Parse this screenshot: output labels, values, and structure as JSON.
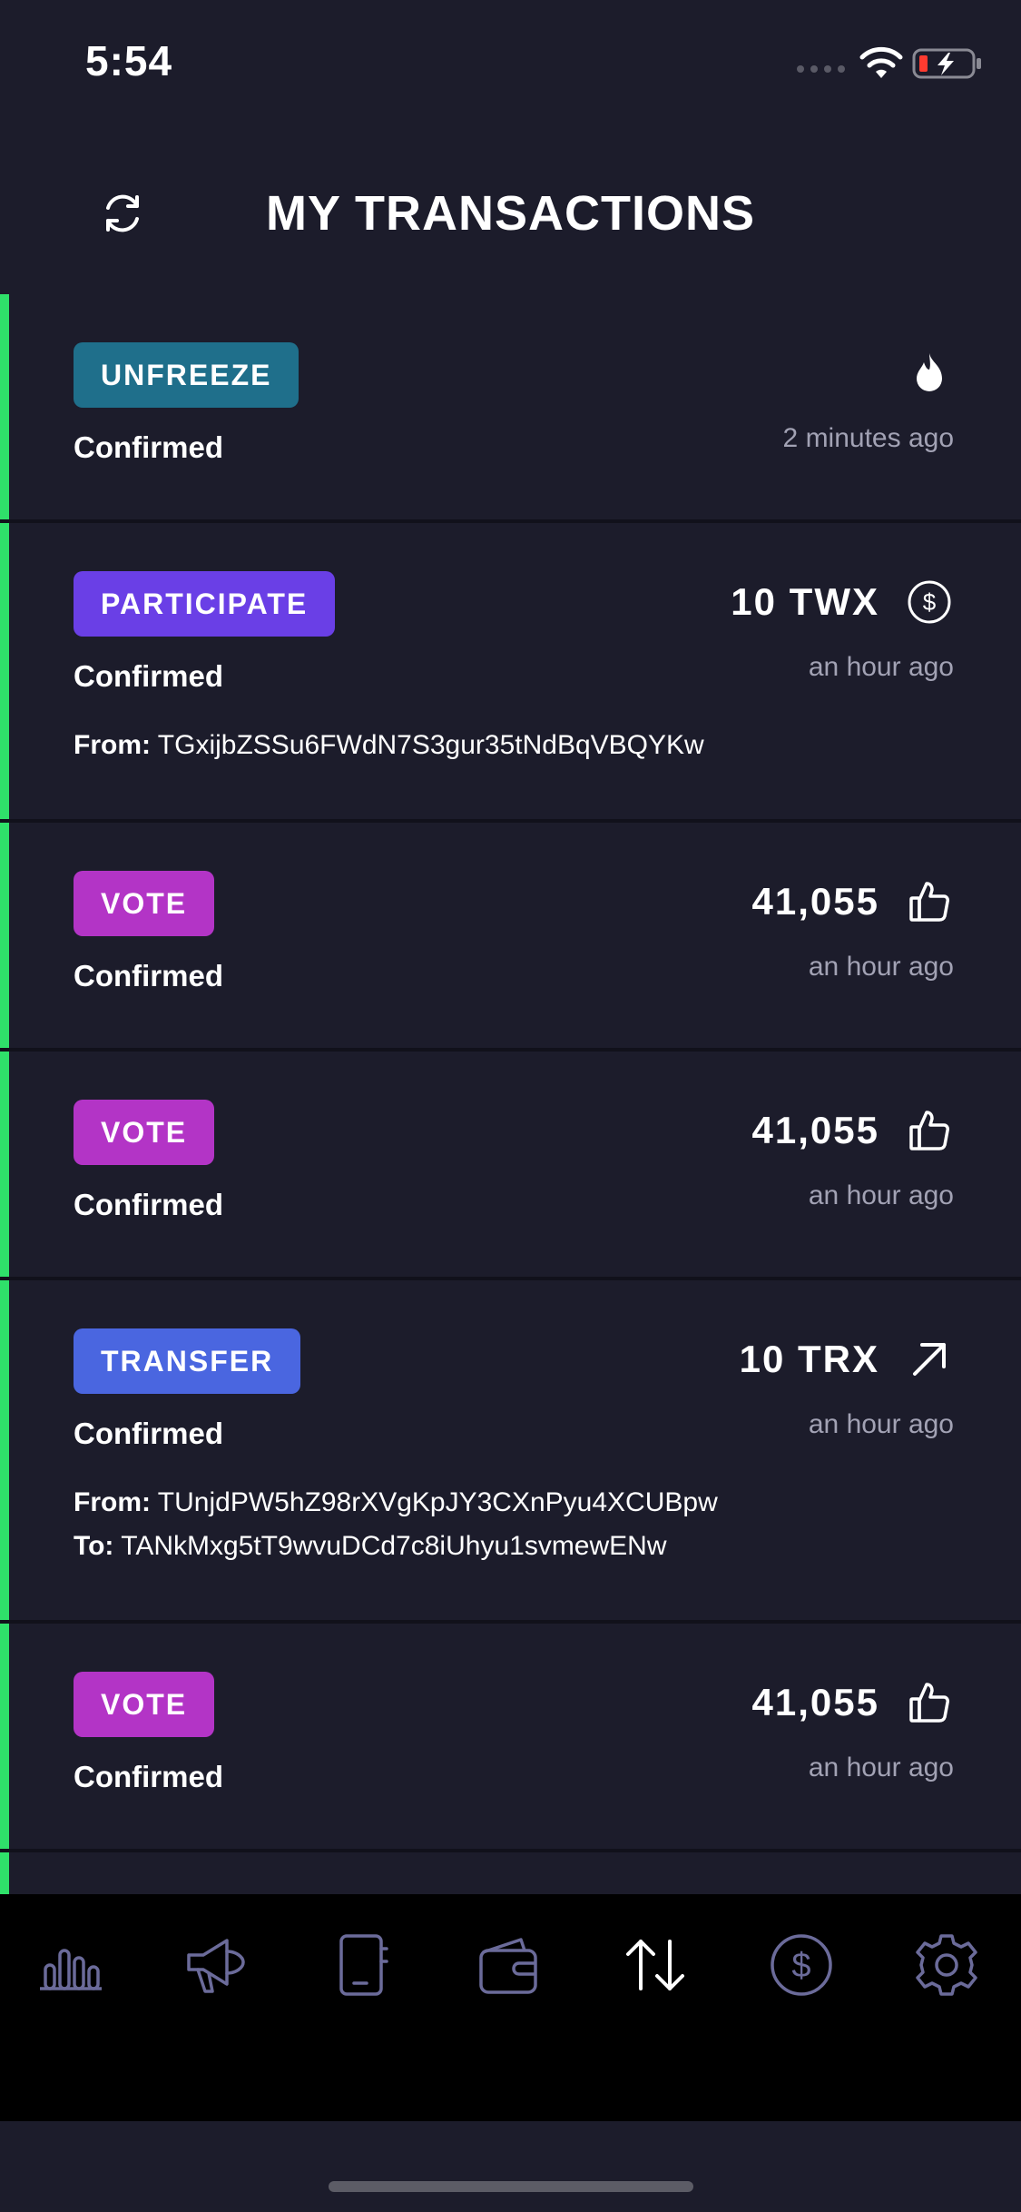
{
  "status_bar": {
    "time": "5:54"
  },
  "header": {
    "title": "MY TRANSACTIONS"
  },
  "colors": {
    "background": "#1c1c2b",
    "accent_green": "#2fe06a",
    "unfreeze": "#1f6f8b",
    "participate": "#6a3fe6",
    "vote": "#b334c6",
    "transfer": "#4a66e0",
    "nav_icon": "#6b6b9a"
  },
  "transactions": [
    {
      "type": "UNFREEZE",
      "status": "Confirmed",
      "time": "2 minutes ago",
      "amount": "",
      "icon": "flame-icon"
    },
    {
      "type": "PARTICIPATE",
      "status": "Confirmed",
      "time": "an hour ago",
      "amount": "10 TWX",
      "icon": "dollar-circle-icon",
      "from_label": "From:",
      "from": "TGxijbZSSu6FWdN7S3gur35tNdBqVBQYKw"
    },
    {
      "type": "VOTE",
      "status": "Confirmed",
      "time": "an hour ago",
      "amount": "41,055",
      "icon": "thumbs-up-icon"
    },
    {
      "type": "VOTE",
      "status": "Confirmed",
      "time": "an hour ago",
      "amount": "41,055",
      "icon": "thumbs-up-icon"
    },
    {
      "type": "TRANSFER",
      "status": "Confirmed",
      "time": "an hour ago",
      "amount": "10 TRX",
      "icon": "arrow-up-right-icon",
      "from_label": "From:",
      "from": "TUnjdPW5hZ98rXVgKpJY3CXnPyu4XCUBpw",
      "to_label": "To:",
      "to": "TANkMxg5tT9wvuDCd7c8iUhyu1svmewENw"
    },
    {
      "type": "VOTE",
      "status": "Confirmed",
      "time": "an hour ago",
      "amount": "41,055",
      "icon": "thumbs-up-icon"
    }
  ],
  "bottom_nav": [
    {
      "icon": "bar-chart-icon",
      "active": false
    },
    {
      "icon": "megaphone-icon",
      "active": false
    },
    {
      "icon": "notebook-icon",
      "active": false
    },
    {
      "icon": "wallet-icon",
      "active": false
    },
    {
      "icon": "transfer-arrows-icon",
      "active": true
    },
    {
      "icon": "dollar-circle-icon",
      "active": false
    },
    {
      "icon": "gear-icon",
      "active": false
    }
  ]
}
